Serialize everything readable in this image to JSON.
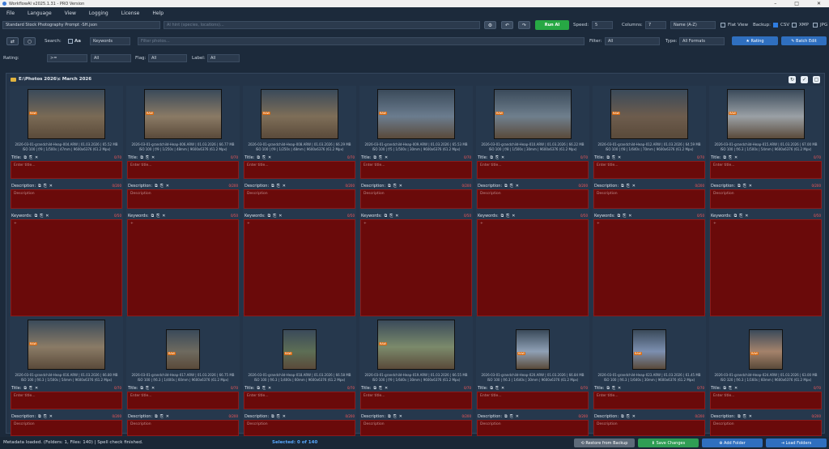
{
  "window": {
    "title": "WorkflowAI v2025.1.31 - PRO Version"
  },
  "menu": [
    "File",
    "Language",
    "View",
    "Logging",
    "License",
    "Help"
  ],
  "toolbar": {
    "prompt_value": "Standard Stock Photography Prompt -SH.json",
    "ai_hint_placeholder": "AI hint (species, locations)...",
    "run_label": "Run AI",
    "speed_label": "Speed:",
    "speed_value": "5",
    "columns_label": "Columns:",
    "columns_value": "7",
    "sort_value": "Name (A-Z)",
    "flat_view_label": "Flat View",
    "backup_label": "Backup:",
    "csv_label": "CSV",
    "xmp_label": "XMP",
    "jpg_label": "JPG"
  },
  "search_row": {
    "search_label": "Search:",
    "case_label": "Aa",
    "keywords_value": "Keywords",
    "filter_placeholder": "Filter photos...",
    "filter_label": "Filter:",
    "filter_value": "All",
    "type_label": "Type:",
    "type_value": "All Formats",
    "rating_btn": "★ Rating",
    "batch_btn": "✎ Batch Edit"
  },
  "rating_row": {
    "rating_label": "Rating:",
    "rating_op": ">=",
    "rating_value": "All",
    "flag_label": "Flag:",
    "flag_value": "All",
    "label_label": "Label:",
    "label_value": "All"
  },
  "breadcrumb": "E:\\Photos 2026\\c March 2026",
  "field_labels": {
    "title": "Title:",
    "description": "Description:",
    "keywords": "Keywords:"
  },
  "placeholders": {
    "title": "Enter title...",
    "description": "Description",
    "keywords": "+"
  },
  "counters": {
    "title": "0/70",
    "description": "0/200",
    "keywords": "0/50"
  },
  "cards_row1": [
    {
      "meta1": "2026-03-01-grandchild-Heap-004.ARW | 01.03.2026 | 65.52 MB",
      "meta2": "ISO 100 | f/9 | 1/500s | 47mm | 9600x6376 (61.2 Mpx)",
      "badge": "RAW"
    },
    {
      "meta1": "2026-03-01-grandchild-Heap-006.ARW | 01.03.2026 | 66.77 MB",
      "meta2": "ISO 100 | f/9 | 1/250s | 48mm | 9600x6376 (61.2 Mpx)",
      "badge": "RAW"
    },
    {
      "meta1": "2026-03-01-grandchild-Heap-008.ARW | 01.03.2026 | 66.29 MB",
      "meta2": "ISO 100 | f/9 | 1/250s | 48mm | 9600x6376 (61.2 Mpx)",
      "badge": "RAW"
    },
    {
      "meta1": "2026-03-01-grandchild-Heap-009.ARW | 01.03.2026 | 65.53 MB",
      "meta2": "ISO 100 | f/5 | 1/500s | 30mm | 9600x6376 (61.2 Mpx)",
      "badge": "RAW"
    },
    {
      "meta1": "2026-03-01-grandchild-Heap-010.ARW | 01.03.2026 | 66.22 MB",
      "meta2": "ISO 100 | f/8 | 1/500s | 30mm | 9600x6376 (61.2 Mpx)",
      "badge": "RAW"
    },
    {
      "meta1": "2026-03-01-grandchild-Heap-012.ARW | 01.03.2026 | 64.59 MB",
      "meta2": "ISO 100 | f/8 | 1/640s | 70mm | 9600x6376 (61.2 Mpx)",
      "badge": "RAW"
    },
    {
      "meta1": "2026-03-01-grandchild-Heap-015.ARW | 01.03.2026 | 67.00 MB",
      "meta2": "ISO 100 | f/6.3 | 1/500s | 54mm | 9600x6376 (61.2 Mpx)",
      "badge": "RAW"
    }
  ],
  "cards_row2": [
    {
      "meta1": "2026-03-01-grandchild-Heap-016.ARW | 01.03.2026 | 66.80 MB",
      "meta2": "ISO 100 | f/6.3 | 1/500s | 54mm | 9600x6376 (61.2 Mpx)",
      "badge": "RAW"
    },
    {
      "meta1": "2026-03-01-grandchild-Heap-017.ARW | 01.03.2026 | 66.75 MB",
      "meta2": "ISO 100 | f/6.3 | 1/400s | 60mm | 9600x6376 (61.2 Mpx)",
      "badge": "RAW"
    },
    {
      "meta1": "2026-03-01-grandchild-Heap-018.ARW | 01.03.2026 | 66.58 MB",
      "meta2": "ISO 100 | f/6.3 | 1/400s | 60mm | 9600x6376 (61.2 Mpx)",
      "badge": "RAW"
    },
    {
      "meta1": "2026-03-01-grandchild-Heap-019.ARW | 01.03.2026 | 66.55 MB",
      "meta2": "ISO 100 | f/9 | 1/640s | 30mm | 9600x6376 (61.2 Mpx)",
      "badge": "RAW"
    },
    {
      "meta1": "2026-03-01-grandchild-Heap-020.ARW | 01.03.2026 | 66.84 MB",
      "meta2": "ISO 100 | f/6.3 | 1/640s | 30mm | 9600x6376 (61.2 Mpx)",
      "badge": "RAW"
    },
    {
      "meta1": "2026-03-01-grandchild-Heap-023.ARW | 01.03.2026 | 61.45 MB",
      "meta2": "ISO 100 | f/6.3 | 1/640s | 30mm | 9600x6376 (61.2 Mpx)",
      "badge": "RAW"
    },
    {
      "meta1": "2026-03-01-grandchild-Heap-024.ARW | 01.03.2026 | 63.00 MB",
      "meta2": "ISO 320 | f/6.3 | 1/160s | 60mm | 9600x6376 (61.2 Mpx)",
      "badge": "RAW"
    }
  ],
  "status": {
    "left": "Metadata loaded. (Folders: 1, Files: 140) | Spell check finished.",
    "selected": "Selected: 0 of 140",
    "restore_btn": "⟲ Restore from Backup",
    "save_btn": "⬇ Save Changes",
    "add_btn": "⊕ Add Folder",
    "load_btn": "⇥ Load Folders"
  },
  "colors": {
    "run_green": "#27a844",
    "save_green": "#2f9e55",
    "blue": "#2f6fbf",
    "field_red": "#6a0a0a"
  }
}
